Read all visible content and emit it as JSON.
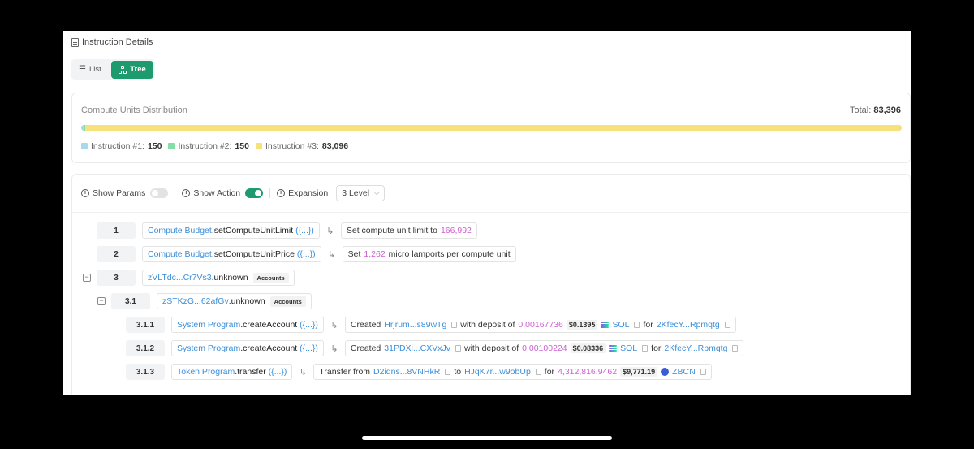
{
  "header": {
    "title": "Instruction Details"
  },
  "view_toggle": {
    "list_label": "List",
    "tree_label": "Tree",
    "active": "Tree"
  },
  "compute_units": {
    "label": "Compute Units Distribution",
    "total_label": "Total:",
    "total_value": "83,396",
    "segments": [
      {
        "name": "Instruction #1:",
        "value": "150",
        "units": 150,
        "color": "#a6d8f0"
      },
      {
        "name": "Instruction #2:",
        "value": "150",
        "units": 150,
        "color": "#86dda7"
      },
      {
        "name": "Instruction #3:",
        "value": "83,096",
        "units": 83096,
        "color": "#f6e17c"
      }
    ]
  },
  "options": {
    "show_params_label": "Show Params",
    "show_params_on": false,
    "show_action_label": "Show Action",
    "show_action_on": true,
    "expansion_label": "Expansion",
    "expansion_value": "3 Level"
  },
  "instructions": {
    "r1": {
      "index": "1",
      "program": "Compute Budget",
      "method": ".setComputeUnitLimit",
      "params": "({...})",
      "action": {
        "text": "Set compute unit limit to",
        "value": "166,992"
      }
    },
    "r2": {
      "index": "2",
      "program": "Compute Budget",
      "method": ".setComputeUnitPrice",
      "params": "({...})",
      "action": {
        "pre": "Set",
        "value": "1,262",
        "post": "micro lamports per compute unit"
      }
    },
    "r3": {
      "index": "3",
      "program": "zVLTdc...Cr7Vs3",
      "method": ".unknown",
      "badge": "Accounts"
    },
    "r31": {
      "index": "3.1",
      "program": "zSTKzG...62afGv",
      "method": ".unknown",
      "badge": "Accounts"
    },
    "r311": {
      "index": "3.1.1",
      "program": "System Program",
      "method": ".createAccount",
      "params": "({...})",
      "action": {
        "created": "Created",
        "account": "Hrjrum...s89wTg",
        "with": "with deposit of",
        "amount": "0.00167736",
        "usd": "$0.1395",
        "token": "SOL",
        "for": "for",
        "owner": "2KfecY...Rpmqtg"
      }
    },
    "r312": {
      "index": "3.1.2",
      "program": "System Program",
      "method": ".createAccount",
      "params": "({...})",
      "action": {
        "created": "Created",
        "account": "31PDXi...CXVxJv",
        "with": "with deposit of",
        "amount": "0.00100224",
        "usd": "$0.08336",
        "token": "SOL",
        "for": "for",
        "owner": "2KfecY...Rpmqtg"
      }
    },
    "r313": {
      "index": "3.1.3",
      "program": "Token Program",
      "method": ".transfer",
      "params": "({...})",
      "action": {
        "transfer": "Transfer from",
        "from": "D2idns...8VNHkR",
        "to_label": "to",
        "to": "HJqK7r...w9obUp",
        "for": "for",
        "amount": "4,312,816.9462",
        "usd": "$9,771.19",
        "token": "ZBCN"
      }
    }
  }
}
